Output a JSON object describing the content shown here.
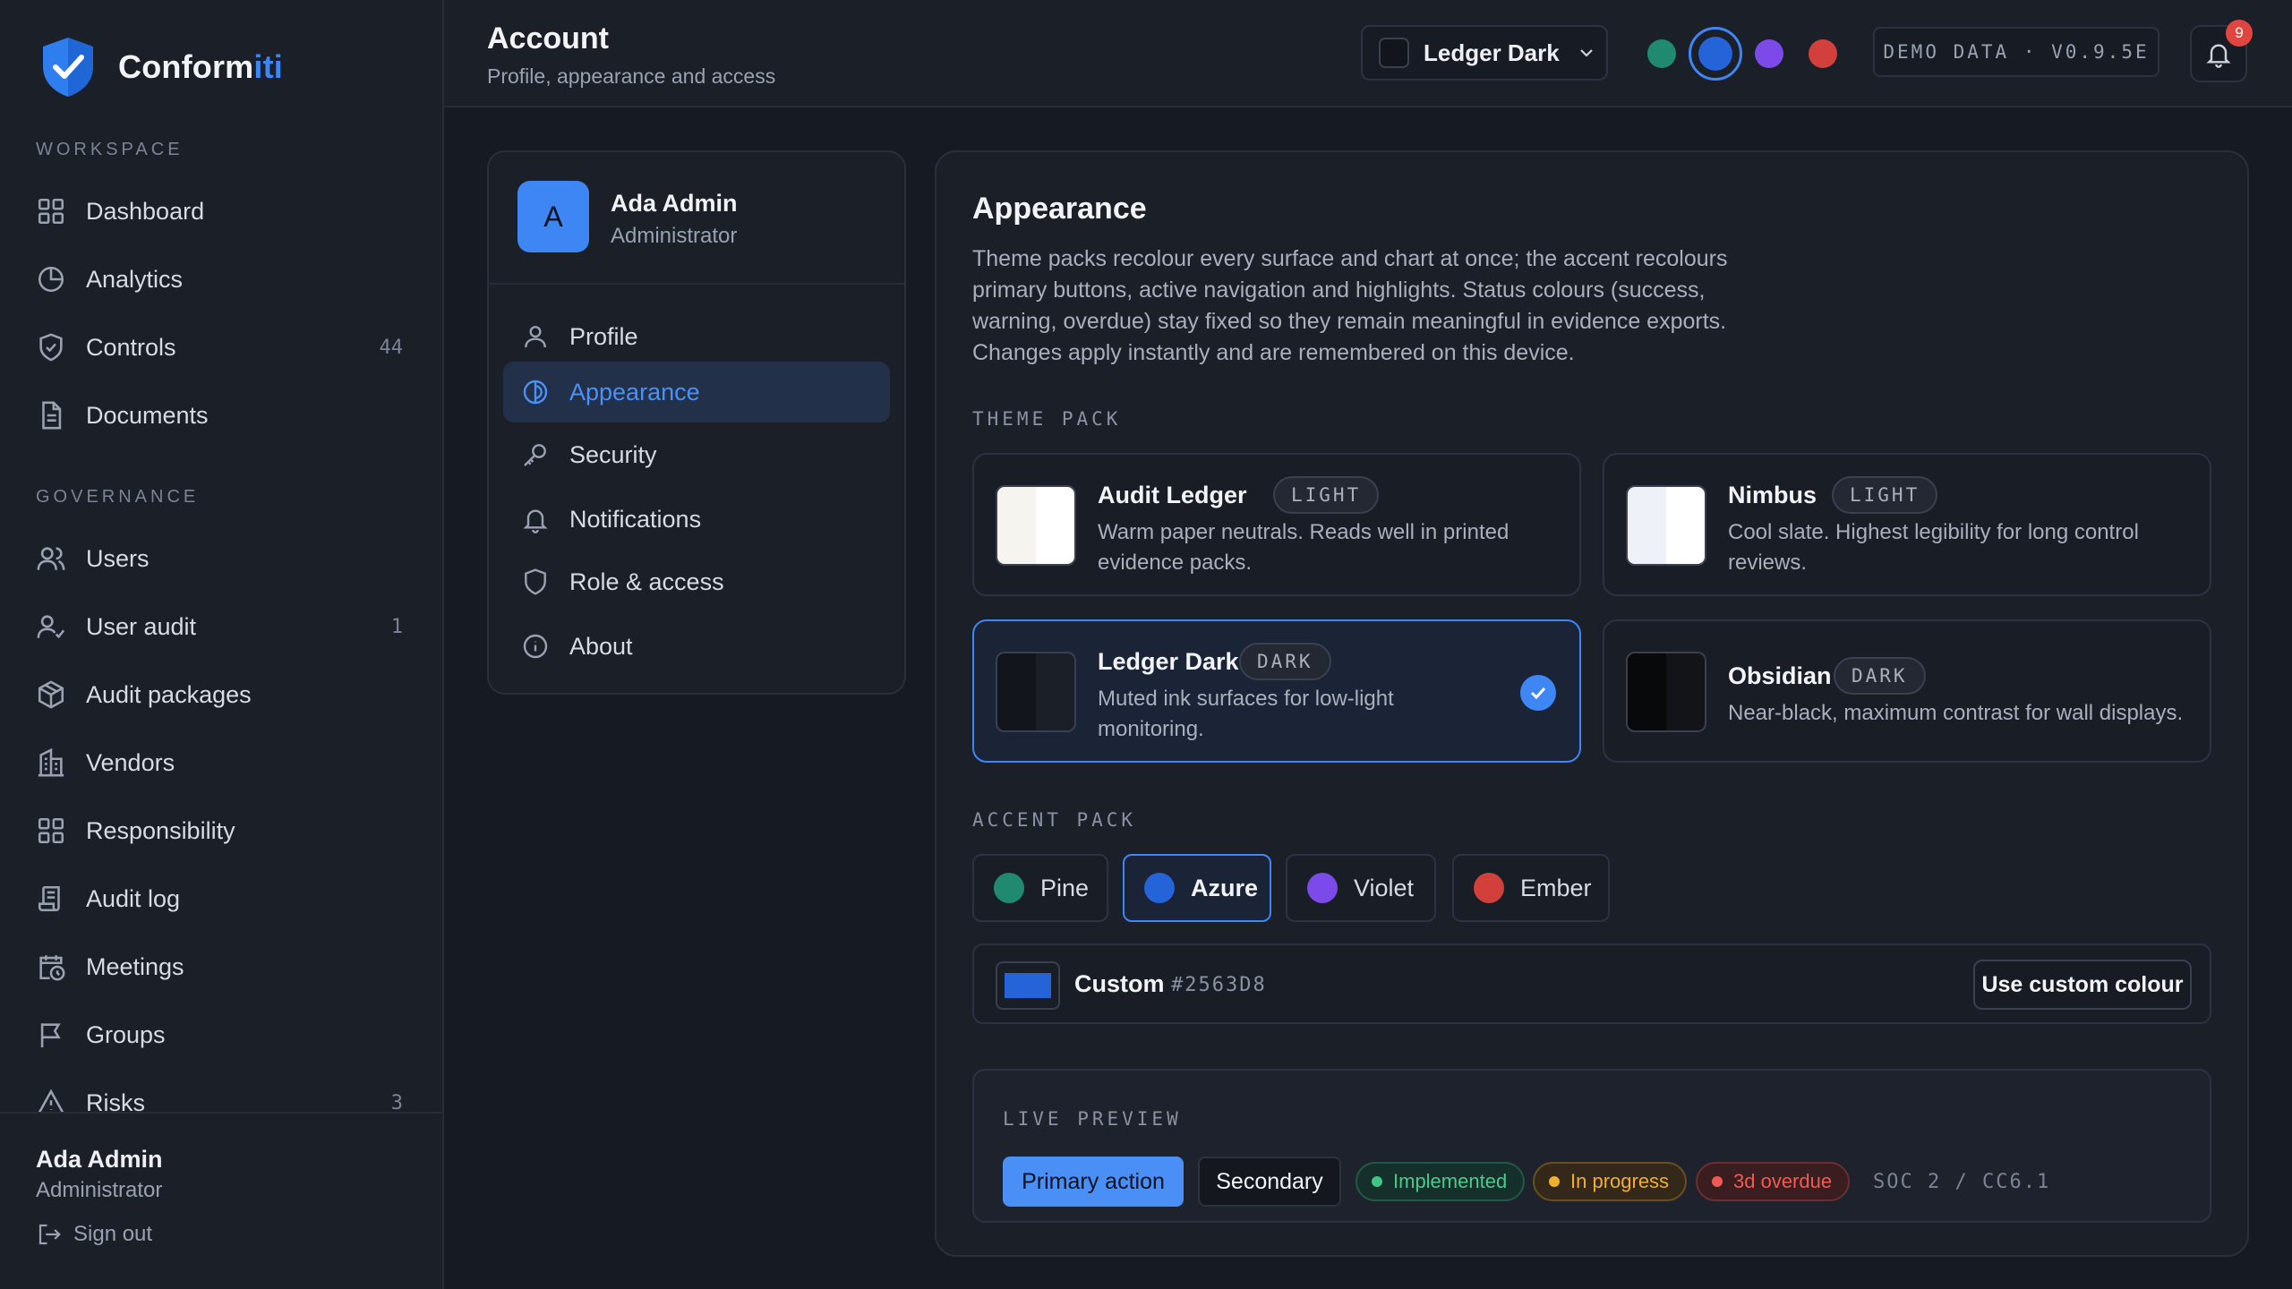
{
  "brand": {
    "name_part1": "Conform",
    "name_part2": "iti"
  },
  "sidebar": {
    "sections": [
      {
        "label": "WORKSPACE"
      },
      {
        "label": "GOVERNANCE"
      }
    ],
    "items": [
      {
        "label": "Dashboard",
        "icon": "grid-icon",
        "count": ""
      },
      {
        "label": "Analytics",
        "icon": "pie-chart-icon",
        "count": ""
      },
      {
        "label": "Controls",
        "icon": "shield-check-icon",
        "count": "44"
      },
      {
        "label": "Documents",
        "icon": "document-icon",
        "count": ""
      },
      {
        "label": "Users",
        "icon": "users-icon",
        "count": ""
      },
      {
        "label": "User audit",
        "icon": "user-check-icon",
        "count": "1"
      },
      {
        "label": "Audit packages",
        "icon": "package-icon",
        "count": ""
      },
      {
        "label": "Vendors",
        "icon": "building-icon",
        "count": ""
      },
      {
        "label": "Responsibility",
        "icon": "grid-icon",
        "count": ""
      },
      {
        "label": "Audit log",
        "icon": "scroll-icon",
        "count": ""
      },
      {
        "label": "Meetings",
        "icon": "calendar-clock-icon",
        "count": ""
      },
      {
        "label": "Groups",
        "icon": "flag-icon",
        "count": ""
      },
      {
        "label": "Risks",
        "icon": "warning-triangle-icon",
        "count": "3"
      }
    ],
    "footer": {
      "name": "Ada Admin",
      "role": "Administrator",
      "signout": "Sign out"
    }
  },
  "header": {
    "title": "Account",
    "subtitle": "Profile, appearance and access",
    "theme_select": "Ledger Dark",
    "accent_dots": [
      "#1f8a70",
      "#2563d8",
      "#7c4ae8",
      "#d1403a"
    ],
    "version": "DEMO DATA · V0.9.5E",
    "notification_count": "9"
  },
  "account": {
    "avatar_initial": "A",
    "name": "Ada Admin",
    "role": "Administrator",
    "nav": [
      {
        "label": "Profile",
        "icon": "user-icon"
      },
      {
        "label": "Appearance",
        "icon": "palette-icon"
      },
      {
        "label": "Security",
        "icon": "key-icon"
      },
      {
        "label": "Notifications",
        "icon": "bell-icon"
      },
      {
        "label": "Role & access",
        "icon": "shield-icon"
      },
      {
        "label": "About",
        "icon": "info-icon"
      }
    ]
  },
  "appearance": {
    "title": "Appearance",
    "description": "Theme packs recolour every surface and chart at once; the accent recolours primary buttons, active navigation and highlights. Status colours (success, warning, overdue) stay fixed so they remain meaningful in evidence exports. Changes apply instantly and are remembered on this device.",
    "theme_pack_label": "THEME PACK",
    "themes": [
      {
        "name": "Audit Ledger",
        "tag": "LIGHT",
        "desc": "Warm paper neutrals. Reads well in printed evidence packs.",
        "colors": [
          "#f6f4ef",
          "#ffffff"
        ]
      },
      {
        "name": "Nimbus",
        "tag": "LIGHT",
        "desc": "Cool slate. Highest legibility for long control reviews.",
        "colors": [
          "#eef2f8",
          "#ffffff"
        ]
      },
      {
        "name": "Ledger Dark",
        "tag": "DARK",
        "desc": "Muted ink surfaces for low-light monitoring.",
        "colors": [
          "#12151b",
          "#1b1f28"
        ]
      },
      {
        "name": "Obsidian",
        "tag": "DARK",
        "desc": "Near-black, maximum contrast for wall displays.",
        "colors": [
          "#08090b",
          "#121418"
        ]
      }
    ],
    "accent_pack_label": "ACCENT PACK",
    "accents": [
      {
        "name": "Pine",
        "color": "#1f8a70"
      },
      {
        "name": "Azure",
        "color": "#2563d8"
      },
      {
        "name": "Violet",
        "color": "#7c4ae8"
      },
      {
        "name": "Ember",
        "color": "#d1403a"
      }
    ],
    "custom": {
      "label": "Custom",
      "hex": "#2563D8",
      "button": "Use custom colour"
    },
    "preview": {
      "label": "LIVE PREVIEW",
      "primary": "Primary action",
      "secondary": "Secondary",
      "implemented": "Implemented",
      "in_progress": "In progress",
      "overdue": "3d overdue",
      "code": "SOC 2 / CC6.1"
    }
  }
}
